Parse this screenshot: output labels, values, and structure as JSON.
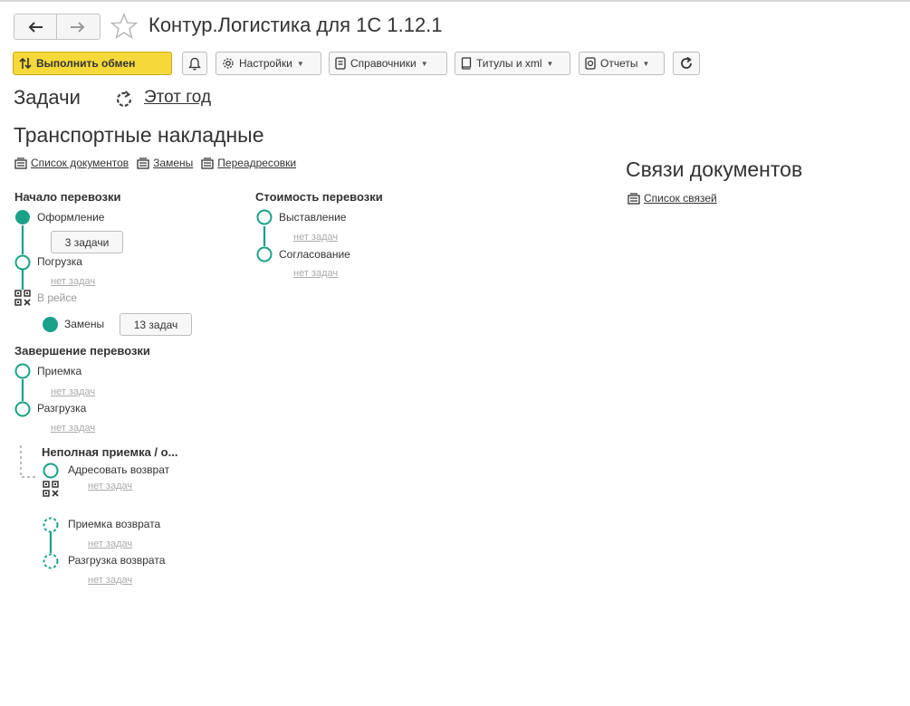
{
  "window": {
    "title": "Контур.Логистика для 1С 1.12.1"
  },
  "nav": {
    "back_icon": "arrow-left-icon",
    "forward_icon": "arrow-right-icon",
    "favorite_icon": "star-icon"
  },
  "toolbar": {
    "exchange": "Выполнить обмен",
    "settings": "Настройки",
    "catalogs": "Справочники",
    "titles": "Титулы и xml",
    "reports": "Отчеты"
  },
  "tasks": {
    "heading": "Задачи",
    "period": "Этот год"
  },
  "waybills": {
    "heading": "Транспортные накладные",
    "links": [
      "Список документов",
      "Замены",
      "Переадресовки"
    ]
  },
  "relations": {
    "heading": "Связи документов",
    "link": "Список связей"
  },
  "start": {
    "title": "Начало перевозки",
    "registration": "Оформление",
    "registration_tasks": "3 задачи",
    "loading": "Погрузка",
    "loading_tasks": "нет задач",
    "in_trip": "В рейсе",
    "replacements": "Замены",
    "replacements_tasks": "13 задач"
  },
  "cost": {
    "title": "Стоимость перевозки",
    "billing": "Выставление",
    "billing_tasks": "нет задач",
    "approval": "Согласование",
    "approval_tasks": "нет задач"
  },
  "finish": {
    "title": "Завершение перевозки",
    "acceptance": "Приемка",
    "acceptance_tasks": "нет задач",
    "unloading": "Разгрузка",
    "unloading_tasks": "нет задач"
  },
  "partial": {
    "title": "Неполная приемка / о...",
    "address_return": "Адресовать возврат",
    "address_return_tasks": "нет задач",
    "return_acceptance": "Приемка возврата",
    "return_acceptance_tasks": "нет задач",
    "return_unloading": "Разгрузка возврата",
    "return_unloading_tasks": "нет задач"
  },
  "colors": {
    "accent": "#1aa189",
    "primary_button": "#f5d93a",
    "muted_link": "#aaaaaa"
  }
}
